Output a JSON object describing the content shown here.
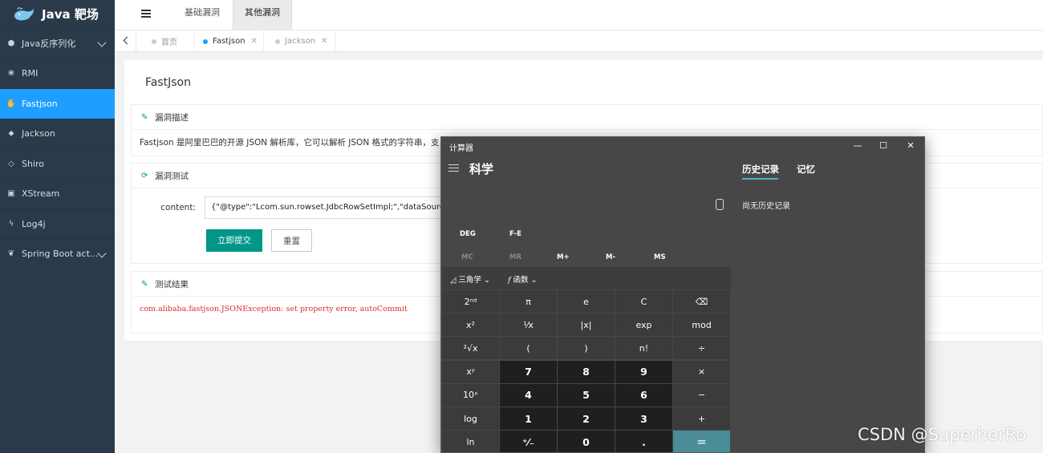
{
  "app": {
    "title": "Java 靶场"
  },
  "sidebar": {
    "items": [
      {
        "label": "Java反序列化",
        "icon": "cube-icon",
        "expandable": true
      },
      {
        "label": "RMI",
        "icon": "paw-icon"
      },
      {
        "label": "Fastjson",
        "icon": "hand-icon",
        "active": true
      },
      {
        "label": "Jackson",
        "icon": "tag-icon"
      },
      {
        "label": "Shiro",
        "icon": "diamond-icon"
      },
      {
        "label": "XStream",
        "icon": "id-card-icon"
      },
      {
        "label": "Log4j",
        "icon": "bolt-icon"
      },
      {
        "label": "Spring Boot act...",
        "icon": "leaf-icon",
        "expandable": true
      }
    ]
  },
  "header": {
    "tabs": [
      "基础漏洞",
      "其他漏洞"
    ],
    "active_tab": "其他漏洞"
  },
  "page_tabs": [
    {
      "label": "首页"
    },
    {
      "label": "Fastjson",
      "active": true
    },
    {
      "label": "Jackson"
    }
  ],
  "page": {
    "title": "FastJson",
    "desc_section": {
      "title": "漏洞描述",
      "text": "Fastjson 是阿里巴巴的开源 JSON 解析库，它可以解析 JSON 格式的字符串，支"
    },
    "test_section": {
      "title": "漏洞测试",
      "content_label": "content:",
      "content_value": "{\"@type\":\"Lcom.sun.rowset.JdbcRowSetImpl;\",\"dataSourceN",
      "submit_label": "立即提交",
      "reset_label": "重置"
    },
    "result_section": {
      "title": "测试结果",
      "text": "com.alibaba.fastjson.JSONException: set property error, autoCommit"
    }
  },
  "calculator": {
    "window_title": "计算器",
    "mode": "科学",
    "history_tab": "历史记录",
    "memory_tab": "记忆",
    "no_history": "尚无历史记录",
    "deg": "DEG",
    "fe": "F-E",
    "memory_buttons": [
      "MC",
      "MR",
      "M+",
      "M-",
      "MS"
    ],
    "trig_label": "三角学",
    "func_label": "函数",
    "keys": [
      [
        "2ⁿᵈ",
        "π",
        "e",
        "C",
        "⌫"
      ],
      [
        "x²",
        "¹⁄x",
        "|x|",
        "exp",
        "mod"
      ],
      [
        "²√x",
        "(",
        ")",
        "n!",
        "÷"
      ],
      [
        "xʸ",
        "7",
        "8",
        "9",
        "×"
      ],
      [
        "10ˣ",
        "4",
        "5",
        "6",
        "−"
      ],
      [
        "log",
        "1",
        "2",
        "3",
        "+"
      ],
      [
        "ln",
        "⁺⁄₋",
        "0",
        ".",
        "="
      ]
    ],
    "accent_color": "#4a8c97"
  },
  "watermark": "CSDN @SuperherRo"
}
